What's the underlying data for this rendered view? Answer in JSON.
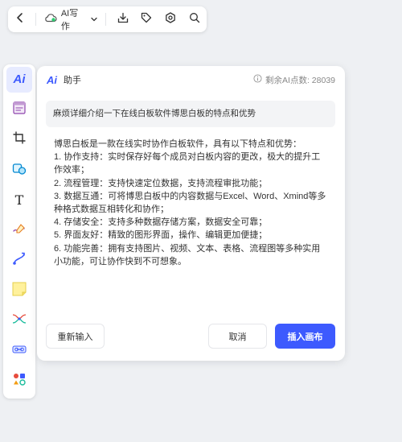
{
  "toolbar": {
    "ai_write_label": "AI写作",
    "icons": [
      "back-icon",
      "cloud-icon",
      "chevron-down-icon",
      "download-icon",
      "tag-icon",
      "settings-icon",
      "search-icon"
    ]
  },
  "sidebar": {
    "items": [
      {
        "icon": "ai-icon",
        "label": "Ai",
        "active": true
      },
      {
        "icon": "frame-icon"
      },
      {
        "icon": "crop-icon"
      },
      {
        "icon": "shapes-icon"
      },
      {
        "icon": "text-icon",
        "label": "T"
      },
      {
        "icon": "pen-icon"
      },
      {
        "icon": "connector-icon"
      },
      {
        "icon": "sticky-note-icon"
      },
      {
        "icon": "mindmap-icon"
      },
      {
        "icon": "link-icon"
      },
      {
        "icon": "more-tools-icon"
      }
    ]
  },
  "panel": {
    "logo": "Ai",
    "title": "助手",
    "quota": "剩余AI点数: 28039",
    "question": "麻烦详细介绍一下在线白板软件博思白板的特点和优势",
    "answer": "博思白板是一款在线实时协作白板软件，具有以下特点和优势：\n1. 协作支持：实时保存好每个成员对白板内容的更改，极大的提升工作效率；\n2. 流程管理：支持快速定位数据，支持流程审批功能；\n3. 数据互通：可将博思白板中的内容数据与Excel、Word、Xmind等多种格式数据互相转化和协作；\n4. 存储安全：支持多种数据存储方案，数据安全可靠；\n5. 界面友好：精致的图形界面，操作、编辑更加便捷；\n6. 功能完善：拥有支持图片、视频、文本、表格、流程图等多种实用小功能，可让协作快到不可想象。",
    "buttons": {
      "reset": "重新输入",
      "cancel": "取消",
      "insert": "插入画布"
    }
  },
  "colors": {
    "accent": "#3d5afe",
    "background": "#eef0f3",
    "panel": "#ffffff",
    "question_bg": "#f3f4f6"
  }
}
